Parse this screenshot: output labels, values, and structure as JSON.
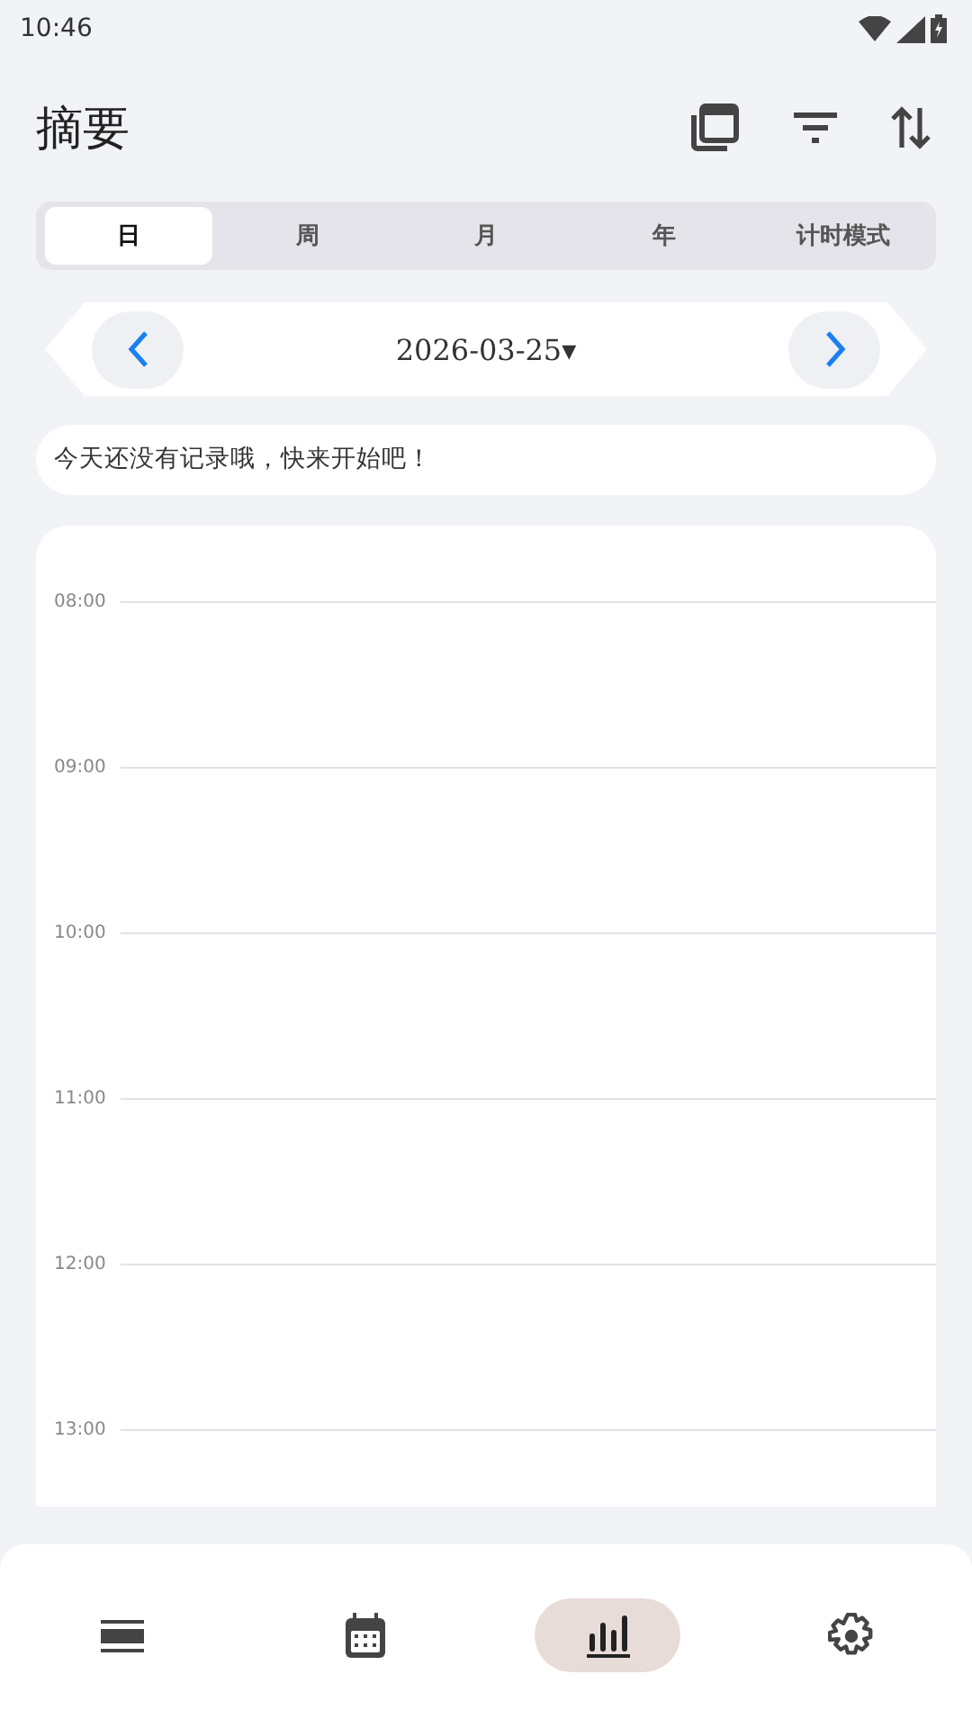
{
  "status_bar": {
    "time": "10:46"
  },
  "header": {
    "title": "摘要"
  },
  "tabs": [
    {
      "label": "日",
      "selected": true
    },
    {
      "label": "周",
      "selected": false
    },
    {
      "label": "月",
      "selected": false
    },
    {
      "label": "年",
      "selected": false
    },
    {
      "label": "计时模式",
      "selected": false
    }
  ],
  "date_nav": {
    "date": "2026-03-25",
    "dropdown": "▾"
  },
  "notice": "今天还没有记录哦，快来开始吧！",
  "timeline": {
    "hours": [
      "08:00",
      "09:00",
      "10:00",
      "11:00",
      "12:00",
      "13:00"
    ]
  },
  "bottom_nav": [
    {
      "kind": "list",
      "selected": false
    },
    {
      "kind": "calendar",
      "selected": false
    },
    {
      "kind": "chart",
      "selected": true
    },
    {
      "kind": "settings",
      "selected": false
    }
  ]
}
